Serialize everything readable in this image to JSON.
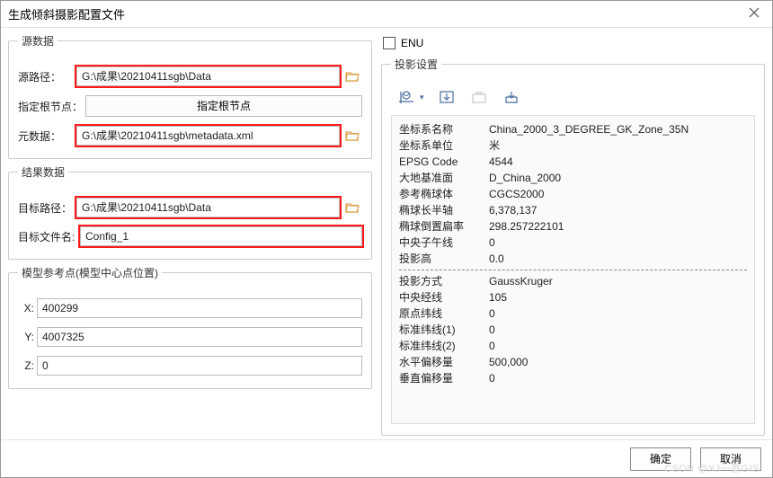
{
  "dialog": {
    "title": "生成倾斜摄影配置文件"
  },
  "source": {
    "legend": "源数据",
    "pathLabel": "源路径：",
    "pathValue": "G:\\成果\\20210411sgb\\Data",
    "rootLabel": "指定根节点：",
    "rootButton": "指定根节点",
    "metaLabel": "元数据：",
    "metaValue": "G:\\成果\\20210411sgb\\metadata.xml"
  },
  "result": {
    "legend": "结果数据",
    "targetPathLabel": "目标路径：",
    "targetPathValue": "G:\\成果\\20210411sgb\\Data",
    "targetFileLabel": "目标文件名:",
    "targetFileValue": "Config_1"
  },
  "reference": {
    "legend": "模型参考点(模型中心点位置)",
    "xLabel": "X:",
    "xValue": "400299",
    "yLabel": "Y:",
    "yValue": "4007325",
    "zLabel": "Z:",
    "zValue": "0"
  },
  "enu": {
    "label": "ENU"
  },
  "projection": {
    "legend": "投影设置",
    "rows1": [
      {
        "k": "坐标系名称",
        "v": "China_2000_3_DEGREE_GK_Zone_35N"
      },
      {
        "k": "坐标系单位",
        "v": "米"
      },
      {
        "k": "EPSG Code",
        "v": "4544"
      },
      {
        "k": "大地基准面",
        "v": "D_China_2000"
      },
      {
        "k": "参考椭球体",
        "v": "CGCS2000"
      },
      {
        "k": "椭球长半轴",
        "v": "6,378,137"
      },
      {
        "k": "椭球倒置扁率",
        "v": "298.257222101"
      },
      {
        "k": "中央子午线",
        "v": "0"
      },
      {
        "k": "投影高",
        "v": "0.0"
      }
    ],
    "rows2": [
      {
        "k": "投影方式",
        "v": "GaussKruger"
      },
      {
        "k": "中央经线",
        "v": "105"
      },
      {
        "k": "原点纬线",
        "v": "0"
      },
      {
        "k": "标准纬线(1)",
        "v": "0"
      },
      {
        "k": "标准纬线(2)",
        "v": "0"
      },
      {
        "k": "水平偏移量",
        "v": "500,000"
      },
      {
        "k": "垂直偏移量",
        "v": "0"
      }
    ]
  },
  "footer": {
    "ok": "确定",
    "cancel": "取消"
  },
  "watermark": "CSDN @XJ一首GIS",
  "icons": {
    "folder": "folder-open-icon"
  }
}
